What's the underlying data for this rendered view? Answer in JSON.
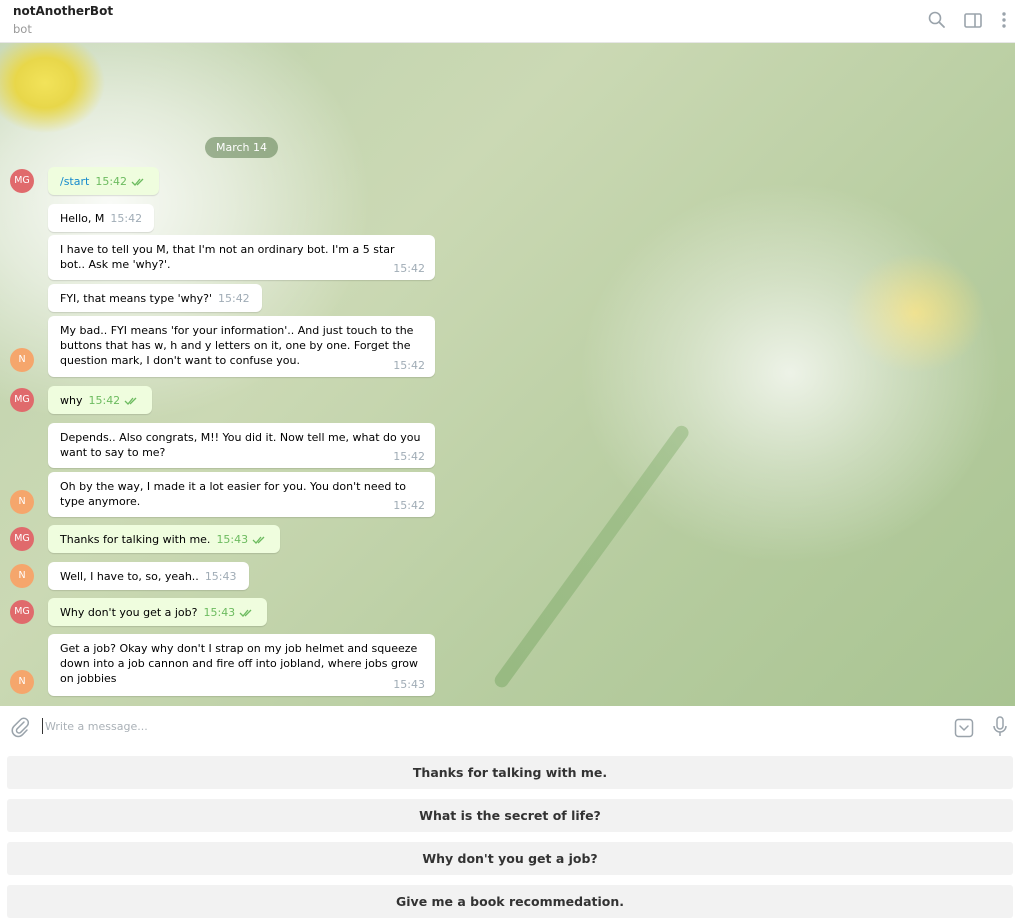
{
  "header": {
    "title": "notAnotherBot",
    "status": "bot"
  },
  "chat": {
    "date": "March 14",
    "messages": [
      {
        "text": "/start",
        "time": "15:42"
      },
      {
        "text": "Hello, M",
        "time": "15:42"
      },
      {
        "text": "I have to tell you M, that I'm not an ordinary bot. I'm a 5 star bot.. Ask me 'why?'.",
        "time": "15:42"
      },
      {
        "text": "FYI, that means type 'why?'",
        "time": "15:42"
      },
      {
        "text": "My bad.. FYI means 'for your information'.. And just touch to the buttons that has w, h and y letters on it, one by one. Forget the question mark, I don't want to confuse you.",
        "time": "15:42"
      },
      {
        "text": "why",
        "time": "15:42"
      },
      {
        "text": "Depends.. Also congrats, M!! You did it. Now tell me, what do you want to say to me?",
        "time": "15:42"
      },
      {
        "text": "Oh by the way, I made it a lot easier for you. You don't need to type anymore.",
        "time": "15:42"
      },
      {
        "text": "Thanks for talking with me.",
        "time": "15:43"
      },
      {
        "text": "Well, I have to, so, yeah..",
        "time": "15:43"
      },
      {
        "text": "Why don't you get a job?",
        "time": "15:43"
      },
      {
        "text": "Get a job? Okay why don't I strap on my job helmet and squeeze down into a job cannon and fire off into jobland, where jobs grow on jobbies",
        "time": "15:43"
      }
    ],
    "avatars": {
      "user": "MG",
      "bot": "N"
    }
  },
  "composer": {
    "placeholder": "Write a message..."
  },
  "keyboard": {
    "buttons": [
      "Thanks for talking with me.",
      "What is the secret of life?",
      "Why don't you get a job?",
      "Give me a book recommedation."
    ]
  },
  "colors": {
    "outgoing_bubble": "#effdde",
    "incoming_bubble": "#ffffff",
    "user_avatar": "#e06a6c",
    "bot_avatar": "#f5a66c",
    "link": "#168acd",
    "read_ticks": "#6cbb5f"
  },
  "icons": [
    "search-icon",
    "sidebar-toggle-icon",
    "more-vertical-icon",
    "attach-icon",
    "keyboard-icon",
    "microphone-icon",
    "double-check-icon"
  ]
}
